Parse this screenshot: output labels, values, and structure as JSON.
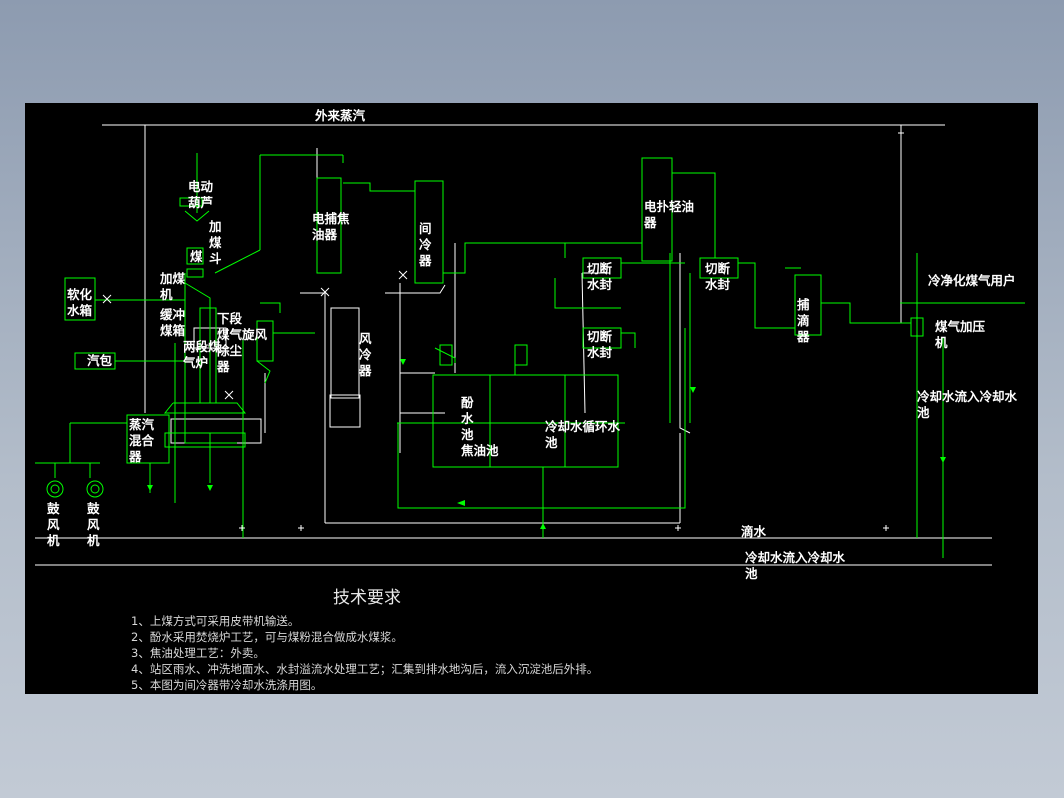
{
  "diagram": {
    "labels": {
      "external_steam": "外来蒸汽",
      "electric_hoist": "电动\n葫芦",
      "coal_hopper": "加\n煤\n斗",
      "coal_label": "煤",
      "feeder": "加煤\n机",
      "buffer_bin": "缓冲\n煤箱",
      "two_stage_gasifier": "两段煤\n气炉",
      "lower_cyclone": "下段\n煤气旋风\n除尘\n器",
      "soft_water_tank": "软化\n水箱",
      "steam_drum": "汽包",
      "steam_mixer": "蒸汽\n混合\n器",
      "blower1": "鼓\n风\n机",
      "blower2": "鼓\n风\n机",
      "esp_tar": "电捕焦\n油器",
      "indirect_cooler": "间\n冷\n器",
      "air_cooler": "风\n冷\n器",
      "esp_light_oil": "电扑轻油\n器",
      "cutoff_seal1": "切断\n水封",
      "cutoff_seal2": "切断\n水封",
      "cutoff_seal3": "切断\n水封",
      "mist_catcher": "捕\n滴\n器",
      "clean_gas_user": "冷净化煤气用户",
      "gas_booster": "煤气加压\n机",
      "phenol_water": "酚\n水\n池",
      "tar_tank": "焦油池",
      "cooling_pool": "冷却水循环水\n池",
      "cw_return_right": "冷却水流入冷却水\n池",
      "drain_water": "滴水",
      "cw_return_bottom": "冷却水流入冷却水\n池"
    }
  },
  "requirements": {
    "title": "技术要求",
    "items": [
      "1、上煤方式可采用皮带机输送。",
      "2、酚水采用焚烧炉工艺，可与煤粉混合做成水煤浆。",
      "3、焦油处理工艺：外卖。",
      "4、站区雨水、冲洗地面水、水封溢流水处理工艺；汇集到排水地沟后，流入沉淀池后外排。",
      "5、本图为间冷器带冷却水洗涤用图。"
    ]
  },
  "colors": {
    "background": "#000000",
    "pipe_white": "#ffffff",
    "pipe_green": "#00ff00",
    "frame": "#8d9bb0"
  }
}
